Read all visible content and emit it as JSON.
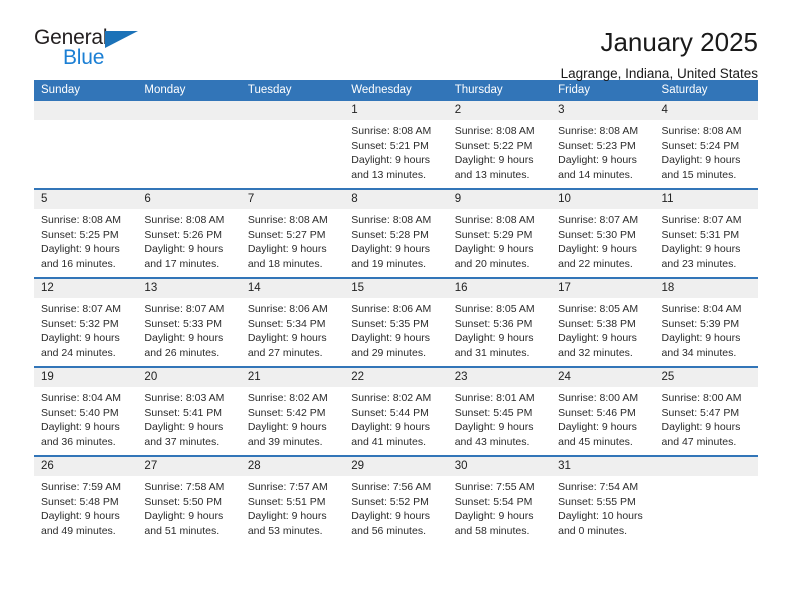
{
  "brand": {
    "name_dark": "General",
    "name_blue": "Blue",
    "color_dark": "#231f20",
    "color_blue": "#1b7fd4",
    "triangle_color": "#1b72b8"
  },
  "header": {
    "title": "January 2025",
    "subtitle": "Lagrange, Indiana, United States",
    "header_bg": "#3275b8",
    "header_text": "#ffffff",
    "number_band_bg": "#efefef"
  },
  "weekdays": [
    "Sunday",
    "Monday",
    "Tuesday",
    "Wednesday",
    "Thursday",
    "Friday",
    "Saturday"
  ],
  "weeks": [
    [
      {
        "day": "",
        "lines": []
      },
      {
        "day": "",
        "lines": []
      },
      {
        "day": "",
        "lines": []
      },
      {
        "day": "1",
        "lines": [
          "Sunrise: 8:08 AM",
          "Sunset: 5:21 PM",
          "Daylight: 9 hours",
          "and 13 minutes."
        ]
      },
      {
        "day": "2",
        "lines": [
          "Sunrise: 8:08 AM",
          "Sunset: 5:22 PM",
          "Daylight: 9 hours",
          "and 13 minutes."
        ]
      },
      {
        "day": "3",
        "lines": [
          "Sunrise: 8:08 AM",
          "Sunset: 5:23 PM",
          "Daylight: 9 hours",
          "and 14 minutes."
        ]
      },
      {
        "day": "4",
        "lines": [
          "Sunrise: 8:08 AM",
          "Sunset: 5:24 PM",
          "Daylight: 9 hours",
          "and 15 minutes."
        ]
      }
    ],
    [
      {
        "day": "5",
        "lines": [
          "Sunrise: 8:08 AM",
          "Sunset: 5:25 PM",
          "Daylight: 9 hours",
          "and 16 minutes."
        ]
      },
      {
        "day": "6",
        "lines": [
          "Sunrise: 8:08 AM",
          "Sunset: 5:26 PM",
          "Daylight: 9 hours",
          "and 17 minutes."
        ]
      },
      {
        "day": "7",
        "lines": [
          "Sunrise: 8:08 AM",
          "Sunset: 5:27 PM",
          "Daylight: 9 hours",
          "and 18 minutes."
        ]
      },
      {
        "day": "8",
        "lines": [
          "Sunrise: 8:08 AM",
          "Sunset: 5:28 PM",
          "Daylight: 9 hours",
          "and 19 minutes."
        ]
      },
      {
        "day": "9",
        "lines": [
          "Sunrise: 8:08 AM",
          "Sunset: 5:29 PM",
          "Daylight: 9 hours",
          "and 20 minutes."
        ]
      },
      {
        "day": "10",
        "lines": [
          "Sunrise: 8:07 AM",
          "Sunset: 5:30 PM",
          "Daylight: 9 hours",
          "and 22 minutes."
        ]
      },
      {
        "day": "11",
        "lines": [
          "Sunrise: 8:07 AM",
          "Sunset: 5:31 PM",
          "Daylight: 9 hours",
          "and 23 minutes."
        ]
      }
    ],
    [
      {
        "day": "12",
        "lines": [
          "Sunrise: 8:07 AM",
          "Sunset: 5:32 PM",
          "Daylight: 9 hours",
          "and 24 minutes."
        ]
      },
      {
        "day": "13",
        "lines": [
          "Sunrise: 8:07 AM",
          "Sunset: 5:33 PM",
          "Daylight: 9 hours",
          "and 26 minutes."
        ]
      },
      {
        "day": "14",
        "lines": [
          "Sunrise: 8:06 AM",
          "Sunset: 5:34 PM",
          "Daylight: 9 hours",
          "and 27 minutes."
        ]
      },
      {
        "day": "15",
        "lines": [
          "Sunrise: 8:06 AM",
          "Sunset: 5:35 PM",
          "Daylight: 9 hours",
          "and 29 minutes."
        ]
      },
      {
        "day": "16",
        "lines": [
          "Sunrise: 8:05 AM",
          "Sunset: 5:36 PM",
          "Daylight: 9 hours",
          "and 31 minutes."
        ]
      },
      {
        "day": "17",
        "lines": [
          "Sunrise: 8:05 AM",
          "Sunset: 5:38 PM",
          "Daylight: 9 hours",
          "and 32 minutes."
        ]
      },
      {
        "day": "18",
        "lines": [
          "Sunrise: 8:04 AM",
          "Sunset: 5:39 PM",
          "Daylight: 9 hours",
          "and 34 minutes."
        ]
      }
    ],
    [
      {
        "day": "19",
        "lines": [
          "Sunrise: 8:04 AM",
          "Sunset: 5:40 PM",
          "Daylight: 9 hours",
          "and 36 minutes."
        ]
      },
      {
        "day": "20",
        "lines": [
          "Sunrise: 8:03 AM",
          "Sunset: 5:41 PM",
          "Daylight: 9 hours",
          "and 37 minutes."
        ]
      },
      {
        "day": "21",
        "lines": [
          "Sunrise: 8:02 AM",
          "Sunset: 5:42 PM",
          "Daylight: 9 hours",
          "and 39 minutes."
        ]
      },
      {
        "day": "22",
        "lines": [
          "Sunrise: 8:02 AM",
          "Sunset: 5:44 PM",
          "Daylight: 9 hours",
          "and 41 minutes."
        ]
      },
      {
        "day": "23",
        "lines": [
          "Sunrise: 8:01 AM",
          "Sunset: 5:45 PM",
          "Daylight: 9 hours",
          "and 43 minutes."
        ]
      },
      {
        "day": "24",
        "lines": [
          "Sunrise: 8:00 AM",
          "Sunset: 5:46 PM",
          "Daylight: 9 hours",
          "and 45 minutes."
        ]
      },
      {
        "day": "25",
        "lines": [
          "Sunrise: 8:00 AM",
          "Sunset: 5:47 PM",
          "Daylight: 9 hours",
          "and 47 minutes."
        ]
      }
    ],
    [
      {
        "day": "26",
        "lines": [
          "Sunrise: 7:59 AM",
          "Sunset: 5:48 PM",
          "Daylight: 9 hours",
          "and 49 minutes."
        ]
      },
      {
        "day": "27",
        "lines": [
          "Sunrise: 7:58 AM",
          "Sunset: 5:50 PM",
          "Daylight: 9 hours",
          "and 51 minutes."
        ]
      },
      {
        "day": "28",
        "lines": [
          "Sunrise: 7:57 AM",
          "Sunset: 5:51 PM",
          "Daylight: 9 hours",
          "and 53 minutes."
        ]
      },
      {
        "day": "29",
        "lines": [
          "Sunrise: 7:56 AM",
          "Sunset: 5:52 PM",
          "Daylight: 9 hours",
          "and 56 minutes."
        ]
      },
      {
        "day": "30",
        "lines": [
          "Sunrise: 7:55 AM",
          "Sunset: 5:54 PM",
          "Daylight: 9 hours",
          "and 58 minutes."
        ]
      },
      {
        "day": "31",
        "lines": [
          "Sunrise: 7:54 AM",
          "Sunset: 5:55 PM",
          "Daylight: 10 hours",
          "and 0 minutes."
        ]
      },
      {
        "day": "",
        "lines": []
      }
    ]
  ]
}
